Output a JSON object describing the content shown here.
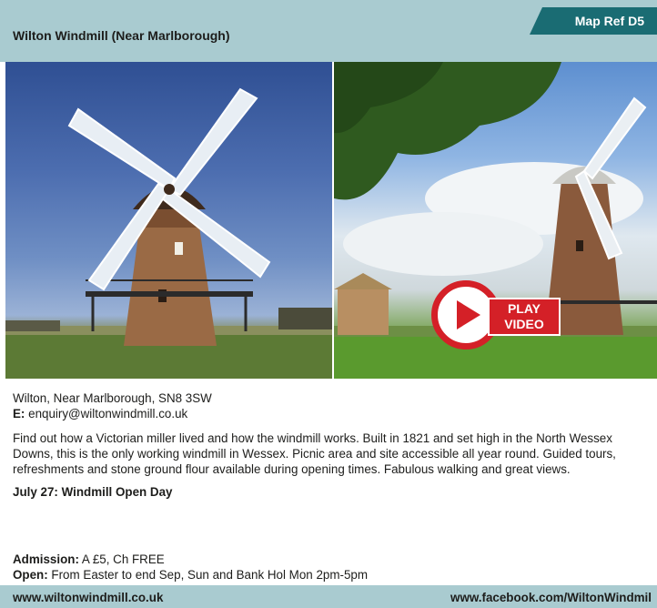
{
  "header": {
    "title": "Wilton Windmill (Near Marlborough)",
    "map_ref": "Map Ref D5"
  },
  "video": {
    "line1": "PLAY",
    "line2": "VIDEO"
  },
  "contact": {
    "address": "Wilton, Near Marlborough, SN8 3SW",
    "email_label": "E:",
    "email": "enquiry@wiltonwindmill.co.uk"
  },
  "description": "Find out how a Victorian miller lived and how the windmill works. Built in 1821 and set high in the North Wessex Downs, this is the only working windmill in Wessex. Picnic area and site accessible all year round. Guided tours, refreshments and stone ground flour available during opening times. Fabulous walking and great views.",
  "event": "July 27: Windmill Open Day",
  "admission": {
    "label": "Admission:",
    "value": "A £5, Ch FREE"
  },
  "open": {
    "label": "Open:",
    "value": "From Easter to end Sep, Sun and Bank Hol Mon 2pm-5pm"
  },
  "footer": {
    "website": "www.wiltonwindmill.co.uk",
    "facebook": "www.facebook.com/WiltonWindmil"
  },
  "colors": {
    "header_bg": "#a9cbd0",
    "map_ref_bg": "#1a6c73",
    "play_red": "#d42027"
  }
}
